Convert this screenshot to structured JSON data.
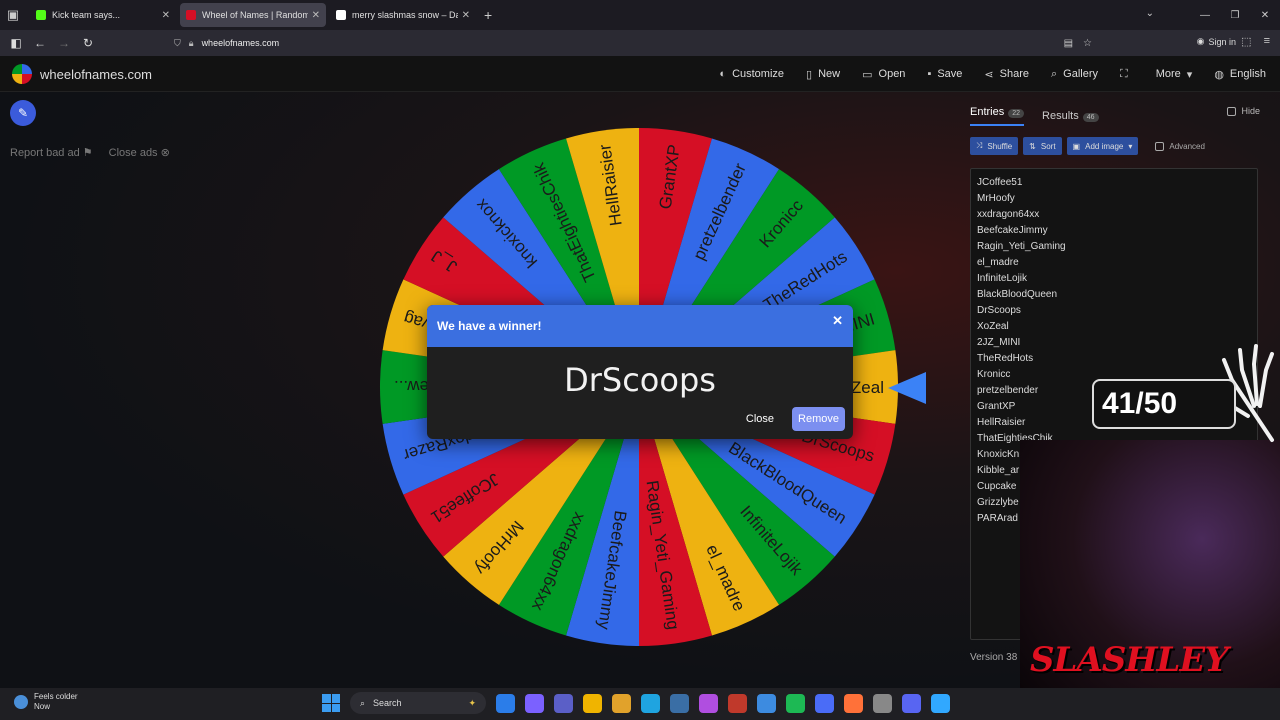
{
  "browser": {
    "tabs": [
      {
        "title": "Kick team says...",
        "favicon_color": "#53fc18",
        "active": false
      },
      {
        "title": "Wheel of Names | Random nam",
        "favicon_color": "#d50f25",
        "active": true
      },
      {
        "title": "merry slashmas snow – Dashbo",
        "favicon_color": "#ffffff",
        "active": false
      }
    ],
    "url": "wheelofnames.com",
    "sign_in": "Sign in"
  },
  "site": {
    "logo_text": "wheelofnames.com",
    "menu": [
      {
        "label": "Customize",
        "icon": "palette-icon"
      },
      {
        "label": "New",
        "icon": "file-icon"
      },
      {
        "label": "Open",
        "icon": "folder-icon"
      },
      {
        "label": "Save",
        "icon": "save-icon"
      },
      {
        "label": "Share",
        "icon": "share-icon"
      },
      {
        "label": "Gallery",
        "icon": "search-icon"
      },
      {
        "label": "",
        "icon": "fullscreen-icon"
      },
      {
        "label": "More",
        "icon": "chevron-down-icon"
      },
      {
        "label": "English",
        "icon": "globe-icon"
      }
    ]
  },
  "ads": {
    "report": "Report bad ad",
    "close": "Close ads"
  },
  "wheel": {
    "segment_colors": [
      "#3369e8",
      "#009925",
      "#eeb211",
      "#d50f25"
    ],
    "segments": [
      "TheRedHots",
      "2JZ_MINI",
      "XoZeal",
      "DrScoops",
      "BlackBloodQueen",
      "InfiniteLojik",
      "el_madre",
      "Ragin_Yeti_Gaming",
      "BeefcakeJimmy",
      "xxdragon64xx",
      "MrHoofy",
      "JCoffee51",
      "PARAradoxRazer",
      "new...",
      "ovag",
      "J_J",
      "knoxicknox",
      "ThatEightiesChik",
      "HellRaisier",
      "GrantXP",
      "pretzelbender",
      "Kronicc"
    ]
  },
  "dialog": {
    "title": "We have a winner!",
    "winner": "DrScoops",
    "close_label": "Close",
    "remove_label": "Remove"
  },
  "panel": {
    "entries_tab": "Entries",
    "entries_count": "22",
    "results_tab": "Results",
    "results_count": "46",
    "hide_label": "Hide",
    "shuffle": "Shuffle",
    "sort": "Sort",
    "add_image": "Add image",
    "advanced": "Advanced",
    "entries": [
      "JCoffee51",
      "MrHoofy",
      "xxdragon64xx",
      "BeefcakeJimmy",
      "Ragin_Yeti_Gaming",
      "el_madre",
      "InfiniteLojik",
      "BlackBloodQueen",
      "DrScoops",
      "XoZeal",
      "2JZ_MINI",
      "TheRedHots",
      "Kronicc",
      "pretzelbender",
      "GrantXP",
      "HellRaisier",
      "ThatEightiesChik",
      "KnoxicKn",
      "Kibble_ar",
      "Cupcake",
      "Grizzlybe",
      "PARArad"
    ],
    "version": "Version 38"
  },
  "overlay": {
    "counter": "41/50",
    "brand": "SLASHLEY"
  },
  "taskbar": {
    "weather_title": "Feels colder",
    "weather_sub": "Now",
    "search": "Search",
    "app_colors": [
      "#2b7de9",
      "#7b61ff",
      "#5b5fc7",
      "#f0b400",
      "#e1a22b",
      "#1fa4e0",
      "#3a6ea5",
      "#b04ee0",
      "#c0392b",
      "#3d8be0",
      "#1db954",
      "#4a6cf7",
      "#ff7139",
      "#888888",
      "#5865f2",
      "#31a8ff"
    ]
  }
}
